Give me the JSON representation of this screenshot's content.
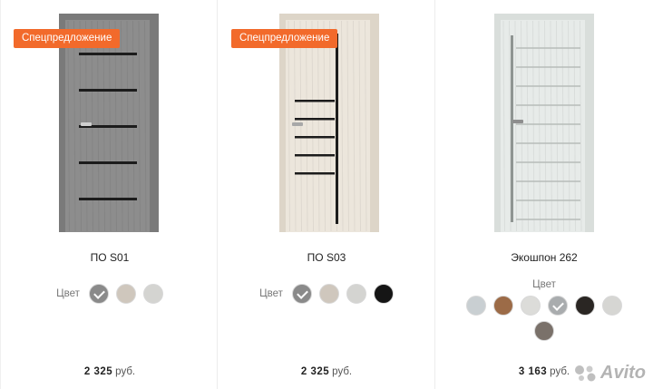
{
  "products": [
    {
      "badge": "Спецпредложение",
      "name": "ПО S01",
      "color_label": "Цвет",
      "swatches": [
        {
          "color": "#8a8a8a",
          "selected": true
        },
        {
          "color": "#cfc7bd",
          "selected": false
        },
        {
          "color": "#d4d4d1",
          "selected": false
        }
      ],
      "price_value": "2 325",
      "price_currency": "руб.",
      "door": {
        "panel": "#8d8d8d",
        "frame": "#7a7a7a",
        "glass": "#1c1c1c"
      }
    },
    {
      "badge": "Спецпредложение",
      "name": "ПО S03",
      "color_label": "Цвет",
      "swatches": [
        {
          "color": "#8a8a8a",
          "selected": true
        },
        {
          "color": "#cfc7bd",
          "selected": false
        },
        {
          "color": "#d4d4d1",
          "selected": false
        },
        {
          "color": "#151515",
          "selected": false
        }
      ],
      "price_value": "2 325",
      "price_currency": "руб.",
      "door": {
        "panel": "#ece6dc",
        "frame": "#ddd5c8",
        "glass": "#1c1c1c"
      }
    },
    {
      "badge": "",
      "name": "Экошпон 262",
      "color_label": "Цвет",
      "swatches": [
        {
          "color": "#c9cfd2",
          "selected": false
        },
        {
          "color": "#9c6b47",
          "selected": false
        },
        {
          "color": "#dcdcd9",
          "selected": false
        },
        {
          "color": "#a9acae",
          "selected": true
        },
        {
          "color": "#2a2623",
          "selected": false
        },
        {
          "color": "#d6d6d3",
          "selected": false
        },
        {
          "color": "#7a716a",
          "selected": false
        }
      ],
      "price_value": "3 163",
      "price_currency": "руб.",
      "door": {
        "panel": "#e7ebe9",
        "frame": "#d9dedb",
        "glass": "#8f9592"
      }
    }
  ],
  "watermark": "Avito",
  "icons": {
    "check": "check-icon",
    "watermark": "avito-logo-icon"
  }
}
